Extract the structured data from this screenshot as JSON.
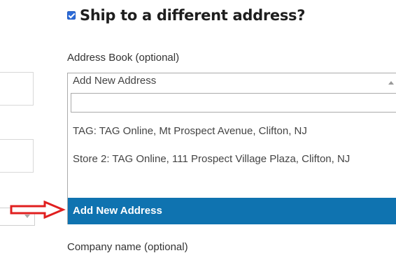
{
  "heading": {
    "text": "Ship to a different address?",
    "checked": true
  },
  "address_book": {
    "label": "Address Book (optional)",
    "selected": "Add New Address",
    "search_value": "",
    "options": [
      "TAG: TAG Online, Mt Prospect Avenue, Clifton, NJ",
      "Store 2: TAG Online, 111 Prospect Village Plaza, Clifton, NJ",
      "Add New Address"
    ],
    "highlighted_index": 2
  },
  "company": {
    "label": "Company name (optional)"
  },
  "colors": {
    "accent": "#0f73b0",
    "checkbox": "#2c6bd8",
    "arrow": "#e01f1f"
  }
}
